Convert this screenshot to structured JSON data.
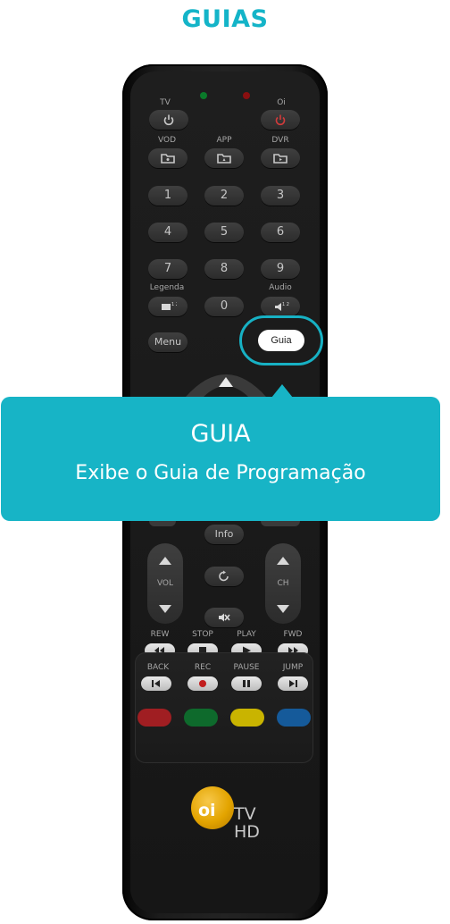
{
  "page": {
    "title": "GUIAS"
  },
  "remote": {
    "labels": {
      "tv": "TV",
      "oi": "Oi",
      "vod": "VOD",
      "app": "APP",
      "dvr": "DVR",
      "legenda": "Legenda",
      "audio": "Audio"
    },
    "numbers": [
      "1",
      "2",
      "3",
      "4",
      "5",
      "6",
      "7",
      "8",
      "9",
      "0"
    ],
    "menu": "Menu",
    "guia": "Guia",
    "info": "Info",
    "vol": "VOL",
    "ch": "CH",
    "transport_labels": {
      "rew": "REW",
      "stop": "STOP",
      "play": "PLAY",
      "fwd": "FWD",
      "back": "BACK",
      "rec": "REC",
      "pause": "PAUSE",
      "jump": "JUMP"
    },
    "logo": {
      "brand": "oi",
      "tv": "TV",
      "hd": "HD"
    }
  },
  "tooltip": {
    "title": "GUIA",
    "description": "Exibe o Guia de Programação"
  },
  "colors": {
    "accent": "#17b4c6",
    "red_key": "#a01e22",
    "green_key": "#0e6a2c",
    "yellow_key": "#c9b400",
    "blue_key": "#155a9a",
    "logo_yellow": "#e3a400"
  },
  "icons": [
    "power-icon",
    "folder-icon",
    "subtitle-icon",
    "audio-icon",
    "up-arrow-icon",
    "down-arrow-icon",
    "refresh-icon",
    "mute-icon",
    "rewind-icon",
    "stop-icon",
    "play-icon",
    "forward-icon",
    "skip-back-icon",
    "record-icon",
    "pause-icon",
    "skip-forward-icon"
  ]
}
